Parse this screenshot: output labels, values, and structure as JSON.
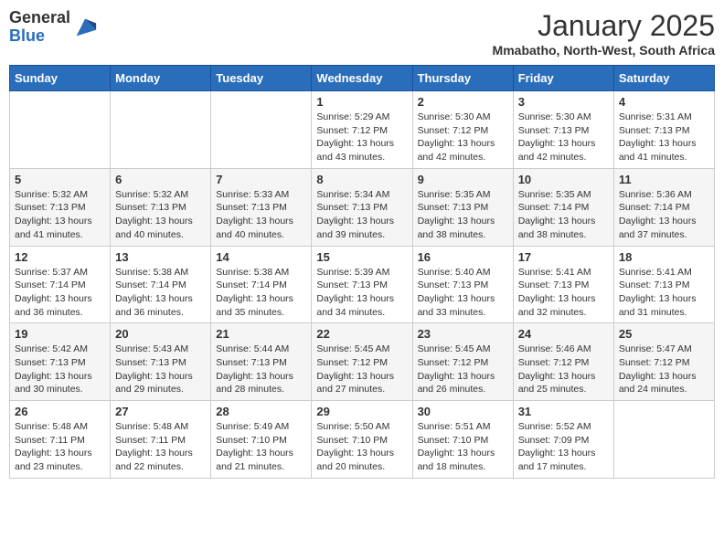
{
  "header": {
    "logo_general": "General",
    "logo_blue": "Blue",
    "month": "January 2025",
    "location": "Mmabatho, North-West, South Africa"
  },
  "days_of_week": [
    "Sunday",
    "Monday",
    "Tuesday",
    "Wednesday",
    "Thursday",
    "Friday",
    "Saturday"
  ],
  "weeks": [
    [
      {
        "day": "",
        "info": ""
      },
      {
        "day": "",
        "info": ""
      },
      {
        "day": "",
        "info": ""
      },
      {
        "day": "1",
        "info": "Sunrise: 5:29 AM\nSunset: 7:12 PM\nDaylight: 13 hours\nand 43 minutes."
      },
      {
        "day": "2",
        "info": "Sunrise: 5:30 AM\nSunset: 7:12 PM\nDaylight: 13 hours\nand 42 minutes."
      },
      {
        "day": "3",
        "info": "Sunrise: 5:30 AM\nSunset: 7:13 PM\nDaylight: 13 hours\nand 42 minutes."
      },
      {
        "day": "4",
        "info": "Sunrise: 5:31 AM\nSunset: 7:13 PM\nDaylight: 13 hours\nand 41 minutes."
      }
    ],
    [
      {
        "day": "5",
        "info": "Sunrise: 5:32 AM\nSunset: 7:13 PM\nDaylight: 13 hours\nand 41 minutes."
      },
      {
        "day": "6",
        "info": "Sunrise: 5:32 AM\nSunset: 7:13 PM\nDaylight: 13 hours\nand 40 minutes."
      },
      {
        "day": "7",
        "info": "Sunrise: 5:33 AM\nSunset: 7:13 PM\nDaylight: 13 hours\nand 40 minutes."
      },
      {
        "day": "8",
        "info": "Sunrise: 5:34 AM\nSunset: 7:13 PM\nDaylight: 13 hours\nand 39 minutes."
      },
      {
        "day": "9",
        "info": "Sunrise: 5:35 AM\nSunset: 7:13 PM\nDaylight: 13 hours\nand 38 minutes."
      },
      {
        "day": "10",
        "info": "Sunrise: 5:35 AM\nSunset: 7:14 PM\nDaylight: 13 hours\nand 38 minutes."
      },
      {
        "day": "11",
        "info": "Sunrise: 5:36 AM\nSunset: 7:14 PM\nDaylight: 13 hours\nand 37 minutes."
      }
    ],
    [
      {
        "day": "12",
        "info": "Sunrise: 5:37 AM\nSunset: 7:14 PM\nDaylight: 13 hours\nand 36 minutes."
      },
      {
        "day": "13",
        "info": "Sunrise: 5:38 AM\nSunset: 7:14 PM\nDaylight: 13 hours\nand 36 minutes."
      },
      {
        "day": "14",
        "info": "Sunrise: 5:38 AM\nSunset: 7:14 PM\nDaylight: 13 hours\nand 35 minutes."
      },
      {
        "day": "15",
        "info": "Sunrise: 5:39 AM\nSunset: 7:13 PM\nDaylight: 13 hours\nand 34 minutes."
      },
      {
        "day": "16",
        "info": "Sunrise: 5:40 AM\nSunset: 7:13 PM\nDaylight: 13 hours\nand 33 minutes."
      },
      {
        "day": "17",
        "info": "Sunrise: 5:41 AM\nSunset: 7:13 PM\nDaylight: 13 hours\nand 32 minutes."
      },
      {
        "day": "18",
        "info": "Sunrise: 5:41 AM\nSunset: 7:13 PM\nDaylight: 13 hours\nand 31 minutes."
      }
    ],
    [
      {
        "day": "19",
        "info": "Sunrise: 5:42 AM\nSunset: 7:13 PM\nDaylight: 13 hours\nand 30 minutes."
      },
      {
        "day": "20",
        "info": "Sunrise: 5:43 AM\nSunset: 7:13 PM\nDaylight: 13 hours\nand 29 minutes."
      },
      {
        "day": "21",
        "info": "Sunrise: 5:44 AM\nSunset: 7:13 PM\nDaylight: 13 hours\nand 28 minutes."
      },
      {
        "day": "22",
        "info": "Sunrise: 5:45 AM\nSunset: 7:12 PM\nDaylight: 13 hours\nand 27 minutes."
      },
      {
        "day": "23",
        "info": "Sunrise: 5:45 AM\nSunset: 7:12 PM\nDaylight: 13 hours\nand 26 minutes."
      },
      {
        "day": "24",
        "info": "Sunrise: 5:46 AM\nSunset: 7:12 PM\nDaylight: 13 hours\nand 25 minutes."
      },
      {
        "day": "25",
        "info": "Sunrise: 5:47 AM\nSunset: 7:12 PM\nDaylight: 13 hours\nand 24 minutes."
      }
    ],
    [
      {
        "day": "26",
        "info": "Sunrise: 5:48 AM\nSunset: 7:11 PM\nDaylight: 13 hours\nand 23 minutes."
      },
      {
        "day": "27",
        "info": "Sunrise: 5:48 AM\nSunset: 7:11 PM\nDaylight: 13 hours\nand 22 minutes."
      },
      {
        "day": "28",
        "info": "Sunrise: 5:49 AM\nSunset: 7:10 PM\nDaylight: 13 hours\nand 21 minutes."
      },
      {
        "day": "29",
        "info": "Sunrise: 5:50 AM\nSunset: 7:10 PM\nDaylight: 13 hours\nand 20 minutes."
      },
      {
        "day": "30",
        "info": "Sunrise: 5:51 AM\nSunset: 7:10 PM\nDaylight: 13 hours\nand 18 minutes."
      },
      {
        "day": "31",
        "info": "Sunrise: 5:52 AM\nSunset: 7:09 PM\nDaylight: 13 hours\nand 17 minutes."
      },
      {
        "day": "",
        "info": ""
      }
    ]
  ]
}
